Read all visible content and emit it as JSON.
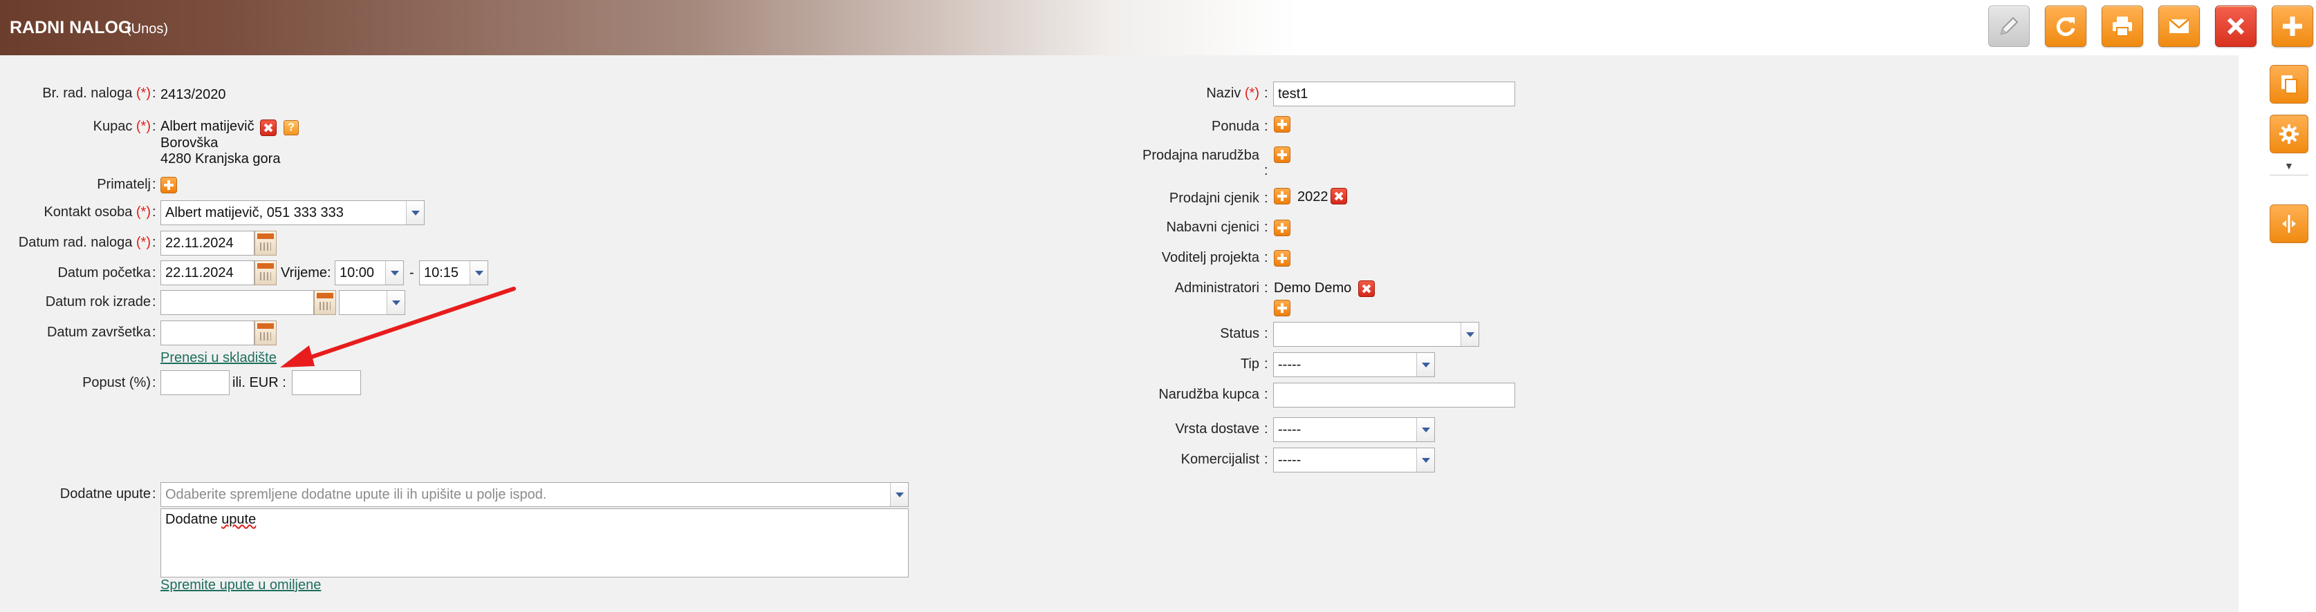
{
  "header": {
    "title": "RADNI NALOG",
    "subtitle": "(Unos)",
    "toolbar": [
      "edit-icon",
      "refresh-icon",
      "print-icon",
      "email-icon",
      "close-icon",
      "add-icon"
    ]
  },
  "right_rail": [
    "copy-icon",
    "settings-icon",
    "split-icon"
  ],
  "required_mark": "(*)",
  "left": {
    "br_naloga": {
      "label": "Br. rad. naloga",
      "value": "2413/2020"
    },
    "kupac": {
      "label": "Kupac",
      "name": "Albert matijevič",
      "street": "Borovška",
      "city": "4280 Kranjska gora"
    },
    "primatelj": {
      "label": "Primatelj"
    },
    "kontakt": {
      "label": "Kontakt osoba",
      "value": "Albert matijevič, 051 333 333"
    },
    "datum_naloga": {
      "label": "Datum rad. naloga",
      "value": "22.11.2024"
    },
    "datum_pocetka": {
      "label": "Datum početka",
      "value": "22.11.2024",
      "vrijeme_label": "Vrijeme:",
      "time_from": "10:00",
      "dash": "-",
      "time_to": "10:15"
    },
    "datum_rok": {
      "label": "Datum rok izrade",
      "value": "",
      "time": ""
    },
    "datum_zavrsetka": {
      "label": "Datum završetka",
      "value": ""
    },
    "prenesi_link": "Prenesi u skladište",
    "popust": {
      "label": "Popust (%)",
      "value": "",
      "ili_label": "ili. EUR",
      "eur_value": ""
    },
    "dodatne_upute": {
      "label": "Dodatne upute",
      "placeholder": "Odaberite spremljene dodatne upute ili ih upišite u polje ispod.",
      "text_word1": "Dodatne",
      "text_word2": "upute",
      "save_link": "Spremite upute u omiljene"
    }
  },
  "right": {
    "naziv": {
      "label": "Naziv",
      "value": "test1"
    },
    "ponuda": {
      "label": "Ponuda"
    },
    "prodajna_narudzba": {
      "label": "Prodajna narudžba"
    },
    "prodajni_cjenik": {
      "label": "Prodajni cjenik",
      "value": "2022"
    },
    "nabavni_cjenici": {
      "label": "Nabavni cjenici"
    },
    "voditelj": {
      "label": "Voditelj projekta"
    },
    "administratori": {
      "label": "Administratori",
      "value": "Demo Demo"
    },
    "status": {
      "label": "Status",
      "value": ""
    },
    "tip": {
      "label": "Tip",
      "value": "-----"
    },
    "narudzba_kupca": {
      "label": "Narudžba kupca",
      "value": ""
    },
    "vrsta_dostave": {
      "label": "Vrsta dostave",
      "value": "-----"
    },
    "komercijalist": {
      "label": "Komercijalist",
      "value": "-----"
    }
  },
  "colors": {
    "accent_orange": "#f08a10",
    "brand_brown": "#6b3d2c",
    "required_red": "#e0201b",
    "link_green": "#1d6e5d",
    "annotation_arrow": "#e81c1c"
  }
}
